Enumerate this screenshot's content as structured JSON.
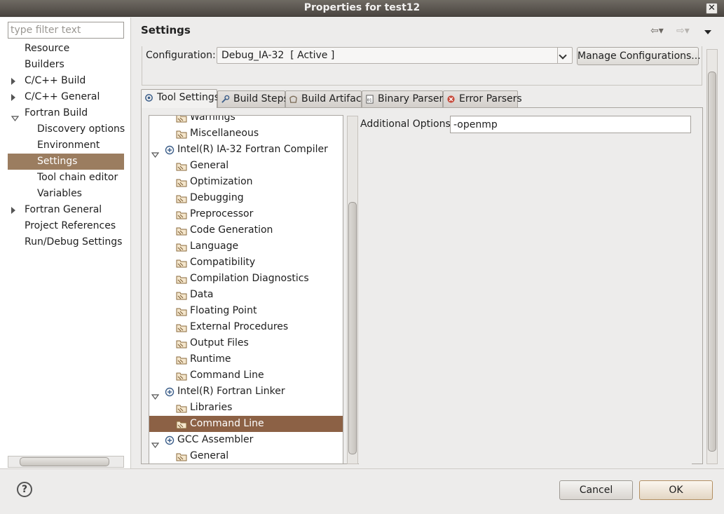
{
  "window": {
    "title": "Properties for test12",
    "close_glyph": "✕"
  },
  "filter": {
    "placeholder": "type filter text"
  },
  "nav": [
    {
      "label": "Resource",
      "expander": "none",
      "selected": false
    },
    {
      "label": "Builders",
      "expander": "none",
      "selected": false
    },
    {
      "label": "C/C++ Build",
      "expander": "collapsed",
      "selected": false
    },
    {
      "label": "C/C++ General",
      "expander": "collapsed",
      "selected": false
    },
    {
      "label": "Fortran Build",
      "expander": "expanded",
      "selected": false
    },
    {
      "label": "Discovery options",
      "expander": "child",
      "selected": false
    },
    {
      "label": "Environment",
      "expander": "child",
      "selected": false
    },
    {
      "label": "Settings",
      "expander": "child",
      "selected": true
    },
    {
      "label": "Tool chain editor",
      "expander": "child",
      "selected": false
    },
    {
      "label": "Variables",
      "expander": "child",
      "selected": false
    },
    {
      "label": "Fortran General",
      "expander": "collapsed",
      "selected": false
    },
    {
      "label": "Project References",
      "expander": "none",
      "selected": false
    },
    {
      "label": "Run/Debug Settings",
      "expander": "none",
      "selected": false
    }
  ],
  "page": {
    "title": "Settings",
    "back_glyph": "⇦▾",
    "forward_glyph": "⇨▾"
  },
  "config": {
    "label": "Configuration:",
    "value": "Debug_IA-32  [ Active ]",
    "manage_label": "Manage Configurations..."
  },
  "tabs": [
    {
      "label": "Tool Settings",
      "active": true,
      "icon": "gear-icon"
    },
    {
      "label": "Build Steps",
      "active": false,
      "icon": "wrench-icon"
    },
    {
      "label": "Build Artifact",
      "active": false,
      "icon": "artifact-icon"
    },
    {
      "label": "Binary Parsers",
      "active": false,
      "icon": "binary-icon"
    },
    {
      "label": "Error Parsers",
      "active": false,
      "icon": "error-icon"
    }
  ],
  "tree": [
    {
      "label": "Warnings",
      "type": "option",
      "selected": false
    },
    {
      "label": "Miscellaneous",
      "type": "option",
      "selected": false
    },
    {
      "label": "Intel(R) IA-32 Fortran Compiler",
      "type": "tool",
      "selected": false
    },
    {
      "label": "General",
      "type": "option",
      "selected": false
    },
    {
      "label": "Optimization",
      "type": "option",
      "selected": false
    },
    {
      "label": "Debugging",
      "type": "option",
      "selected": false
    },
    {
      "label": "Preprocessor",
      "type": "option",
      "selected": false
    },
    {
      "label": "Code Generation",
      "type": "option",
      "selected": false
    },
    {
      "label": "Language",
      "type": "option",
      "selected": false
    },
    {
      "label": "Compatibility",
      "type": "option",
      "selected": false
    },
    {
      "label": "Compilation Diagnostics",
      "type": "option",
      "selected": false
    },
    {
      "label": "Data",
      "type": "option",
      "selected": false
    },
    {
      "label": "Floating Point",
      "type": "option",
      "selected": false
    },
    {
      "label": "External Procedures",
      "type": "option",
      "selected": false
    },
    {
      "label": "Output Files",
      "type": "option",
      "selected": false
    },
    {
      "label": "Runtime",
      "type": "option",
      "selected": false
    },
    {
      "label": "Command Line",
      "type": "option",
      "selected": false
    },
    {
      "label": "Intel(R) Fortran Linker",
      "type": "tool",
      "selected": false
    },
    {
      "label": "Libraries",
      "type": "option",
      "selected": false
    },
    {
      "label": "Command Line",
      "type": "option",
      "selected": true
    },
    {
      "label": "GCC Assembler",
      "type": "tool",
      "selected": false
    },
    {
      "label": "General",
      "type": "option",
      "selected": false
    }
  ],
  "options": {
    "label": "Additional Options",
    "value": "-openmp"
  },
  "buttons": {
    "help_glyph": "?",
    "cancel": "Cancel",
    "ok": "OK"
  },
  "colors": {
    "selection": "#9b7d60",
    "tree_selection": "#8c6145",
    "titlebar": "#4a4540"
  }
}
